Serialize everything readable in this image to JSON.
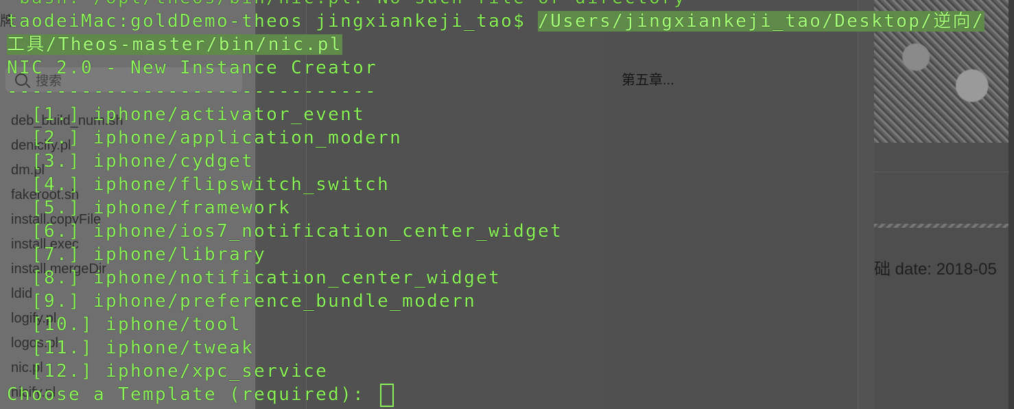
{
  "finder": {
    "header_text": "牌",
    "search_placeholder": "搜索",
    "files": [
      "deb_build_num.sh",
      "denicify.pl",
      "dm.pl",
      "fakeroot.sh",
      "install.copyFile",
      "install.exec",
      "install.mergeDir",
      "ldid",
      "logify.pl",
      "logos.pl",
      "nic.pl",
      "nicify.pl"
    ]
  },
  "notes": {
    "chapter_text": "第五章...",
    "date_text": "础 date: 2018-05"
  },
  "terminal": {
    "line0": " bash: /opt/theos/bin/nic.pl: No such file or directory",
    "prompt": "taodeiMac:goldDemo-theos jingxiankeji_tao$ ",
    "command_part1": "/Users/jingxiankeji_tao/Desktop/逆向/",
    "command_part2": "工具/Theos-master/bin/nic.pl",
    "banner": "NIC 2.0 - New Instance Creator",
    "separator": "------------------------------",
    "templates": [
      "  [1.] iphone/activator_event",
      "  [2.] iphone/application_modern",
      "  [3.] iphone/cydget",
      "  [4.] iphone/flipswitch_switch",
      "  [5.] iphone/framework",
      "  [6.] iphone/ios7_notification_center_widget",
      "  [7.] iphone/library",
      "  [8.] iphone/notification_center_widget",
      "  [9.] iphone/preference_bundle_modern",
      "  [10.] iphone/tool",
      "  [11.] iphone/tweak",
      "  [12.] iphone/xpc_service"
    ],
    "choose_prompt": "Choose a Template (required): "
  },
  "colors": {
    "terminal_text": "#8cf25a",
    "selection": "#5f8a4a",
    "background": "#4b4b4b"
  }
}
